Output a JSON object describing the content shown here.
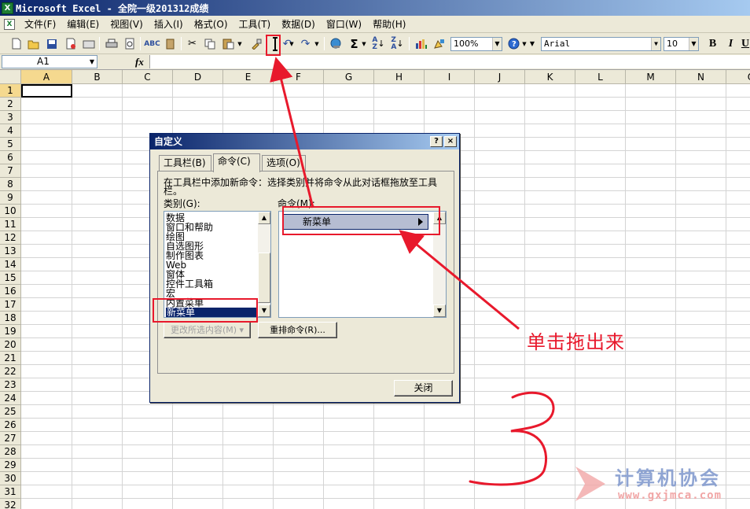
{
  "window": {
    "title": "Microsoft Excel - 全院一级201312成绩"
  },
  "menu": {
    "items": [
      {
        "label": "文件(F)"
      },
      {
        "label": "编辑(E)"
      },
      {
        "label": "视图(V)"
      },
      {
        "label": "插入(I)"
      },
      {
        "label": "格式(O)"
      },
      {
        "label": "工具(T)"
      },
      {
        "label": "数据(D)"
      },
      {
        "label": "窗口(W)"
      },
      {
        "label": "帮助(H)"
      }
    ]
  },
  "toolbar": {
    "zoom": "100%",
    "font_name": "Arial",
    "font_size": "10",
    "bold": "B",
    "italic": "I",
    "underline": "U"
  },
  "formula_bar": {
    "name_box": "A1",
    "fx": "fx",
    "value": ""
  },
  "sheet": {
    "columns": [
      "A",
      "B",
      "C",
      "D",
      "E",
      "F",
      "G",
      "H",
      "I",
      "J",
      "K",
      "L",
      "M",
      "N",
      "O"
    ],
    "rows": [
      "1",
      "2",
      "3",
      "4",
      "5",
      "6",
      "7",
      "8",
      "9",
      "10",
      "11",
      "12",
      "13",
      "14",
      "15",
      "16",
      "17",
      "18",
      "19",
      "20",
      "21",
      "22",
      "23",
      "24",
      "25",
      "26",
      "27",
      "28",
      "29",
      "30",
      "31",
      "32"
    ],
    "active_cell": "A1"
  },
  "dialog": {
    "title": "自定义",
    "help_button": "?",
    "close_button": "×",
    "tabs": [
      {
        "label": "工具栏(B)",
        "active": false
      },
      {
        "label": "命令(C)",
        "active": true
      },
      {
        "label": "选项(O)",
        "active": false
      }
    ],
    "instruction_line1": "在工具栏中添加新命令：选择类别并将命令从此对话框拖放至工具",
    "instruction_line2": "栏。",
    "categories_label": "类别(G):",
    "commands_label": "命令(M):",
    "categories": [
      "数据",
      "窗口和帮助",
      "绘图",
      "自选图形",
      "制作图表",
      "Web",
      "窗体",
      "控件工具箱",
      "宏",
      "内置菜单",
      "新菜单"
    ],
    "selected_category": "新菜单",
    "commands": [
      "新菜单"
    ],
    "modify_selection_button": "更改所选内容(M) ▾",
    "rearrange_button": "重排命令(R)...",
    "close_dialog_button": "关闭"
  },
  "annotations": {
    "instruction": "单击拖出来",
    "step_number": "3",
    "accent_color": "#e8192c"
  },
  "watermark": {
    "text": "计算机协会",
    "url": "www.gxjmca.com"
  }
}
